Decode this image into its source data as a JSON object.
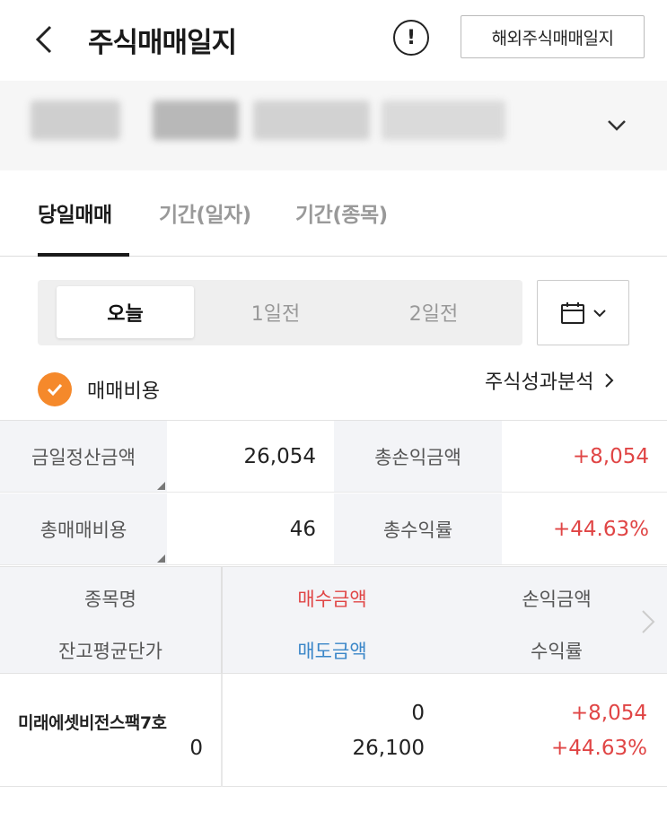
{
  "header": {
    "title": "주식매매일지",
    "info_icon": "!",
    "overseas_button": "해외주식매매일지"
  },
  "tabs": [
    {
      "label": "당일매매",
      "active": true
    },
    {
      "label": "기간(일자)",
      "active": false
    },
    {
      "label": "기간(종목)",
      "active": false
    }
  ],
  "day_segment": [
    {
      "label": "오늘",
      "active": true
    },
    {
      "label": "1일전",
      "active": false
    },
    {
      "label": "2일전",
      "active": false
    }
  ],
  "fee_option": {
    "label": "매매비용",
    "checked": true
  },
  "analysis_link": "주식성과분석",
  "summary": {
    "settlement_label": "금일정산금액",
    "settlement_value": "26,054",
    "total_pnl_label": "총손익금액",
    "total_pnl_value": "+8,054",
    "total_fee_label": "총매매비용",
    "total_fee_value": "46",
    "total_return_label": "총수익률",
    "total_return_value": "+44.63%"
  },
  "table": {
    "headers": {
      "name": "종목명",
      "avg_price": "잔고평균단가",
      "buy_amount": "매수금액",
      "sell_amount": "매도금액",
      "pnl": "손익금액",
      "return": "수익률"
    },
    "rows": [
      {
        "name": "미래에셋비전스팩7호",
        "avg_price": "0",
        "buy_amount": "0",
        "sell_amount": "26,100",
        "pnl": "+8,054",
        "return": "+44.63%"
      }
    ]
  },
  "colors": {
    "accent": "#f5892b",
    "positive": "#e04545",
    "sell": "#3a86c8",
    "label_bg": "#f3f4f7"
  }
}
